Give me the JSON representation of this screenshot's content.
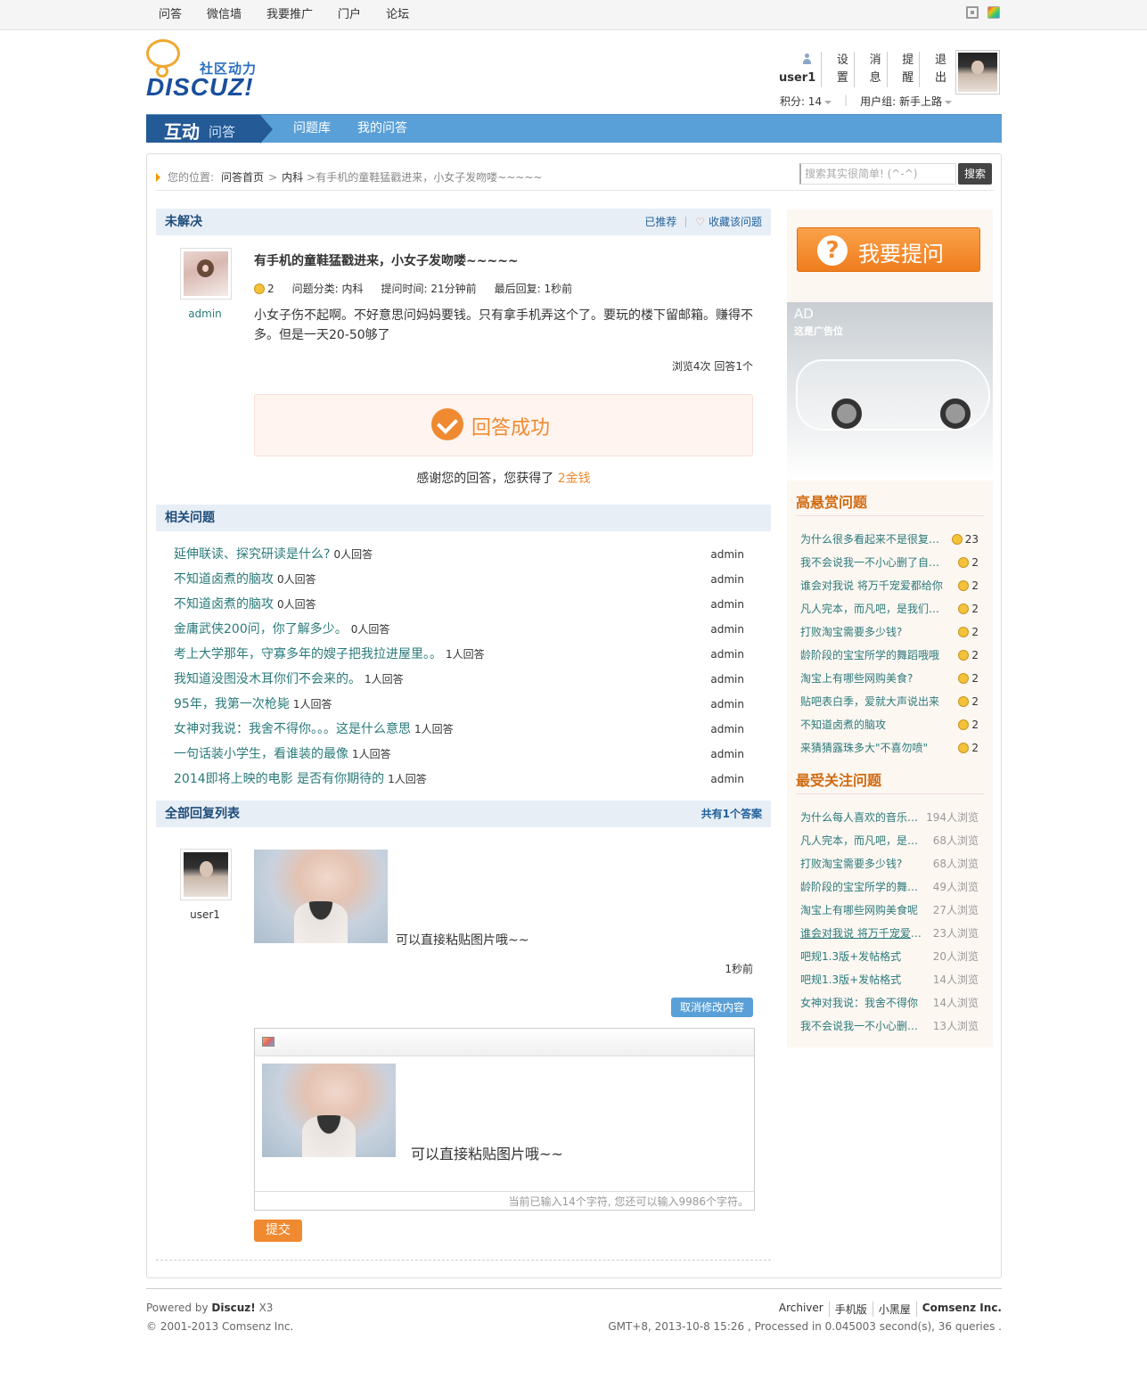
{
  "topnav": {
    "items": [
      "问答",
      "微信墙",
      "我要推广",
      "门户",
      "论坛"
    ]
  },
  "logo": {
    "subtitle": "社区动力",
    "brand": "DISCUZ!"
  },
  "user": {
    "name": "user1",
    "links": [
      "设置",
      "消息",
      "提醒",
      "退出"
    ],
    "points_label": "积分: 14",
    "group_label": "用户组: 新手上路"
  },
  "bluenav": {
    "brand_main": "互动",
    "brand_sub": "问答",
    "links": [
      "问题库",
      "我的问答"
    ]
  },
  "breadcrumb": {
    "prefix": "您的位置:",
    "home": "问答首页",
    "sep": ">",
    "category": "内科",
    "current": ">有手机的童鞋猛戳进来，小女子发吻喽~~~~~"
  },
  "search": {
    "placeholder": "搜索其实很简单! (^-^)",
    "button": "搜索"
  },
  "question": {
    "status": "未解决",
    "recommended": "已推荐",
    "favorite": "收藏该问题",
    "author": "admin",
    "title": "有手机的童鞋猛戳进来，小女子发吻喽~~~~~",
    "reward": "2",
    "category": "问题分类: 内科",
    "asked": "提问时间: 21分钟前",
    "last_reply": "最后回复: 1秒前",
    "body": "小女子伤不起啊。不好意思问妈妈要钱。只有拿手机弄这个了。要玩的楼下留邮箱。赚得不多。但是一天20-50够了",
    "stats": "浏览4次 回答1个"
  },
  "success": {
    "message": "回答成功",
    "thanks_prefix": "感谢您的回答，您获得了",
    "thanks_reward": "2金钱"
  },
  "related": {
    "title": "相关问题",
    "items": [
      {
        "title": "延伸联读、探究研读是什么?",
        "count": "0人回答",
        "author": "admin"
      },
      {
        "title": "不知道卤煮的脑攻",
        "count": "0人回答",
        "author": "admin"
      },
      {
        "title": "不知道卤煮的脑攻",
        "count": "0人回答",
        "author": "admin"
      },
      {
        "title": "金庸武侠200问，你了解多少。",
        "count": "0人回答",
        "author": "admin"
      },
      {
        "title": "考上大学那年，守寡多年的嫂子把我拉进屋里。。",
        "count": "1人回答",
        "author": "admin"
      },
      {
        "title": "我知道没图没木耳你们不会来的。",
        "count": "1人回答",
        "author": "admin"
      },
      {
        "title": "95年，我第一次枪毙",
        "count": "1人回答",
        "author": "admin"
      },
      {
        "title": "女神对我说：我舍不得你。。。这是什么意思",
        "count": "1人回答",
        "author": "admin"
      },
      {
        "title": "一句话装小学生，看谁装的最像",
        "count": "1人回答",
        "author": "admin"
      },
      {
        "title": "2014即将上映的电影 是否有你期待的",
        "count": "1人回答",
        "author": "admin"
      }
    ]
  },
  "replies": {
    "title": "全部回复列表",
    "total_prefix": "共有",
    "total_count": "1",
    "total_suffix": "个答案",
    "item": {
      "author": "user1",
      "text": "可以直接粘贴图片哦~~",
      "time": "1秒前"
    },
    "cancel_button": "取消修改内容"
  },
  "editor": {
    "text": "可以直接粘贴图片哦~~",
    "counter": "当前已输入14个字符, 您还可以输入9986个字符。",
    "submit": "提交"
  },
  "sidebar": {
    "ask_button": "我要提问",
    "ask_icon_glyph": "?",
    "ad_title": "AD",
    "ad_subtitle": "这是广告位",
    "reward_title": "高悬赏问题",
    "reward_items": [
      {
        "title": "为什么很多看起来不是很复杂的网站",
        "value": "23"
      },
      {
        "title": "我不会说我一不小心删了自己的",
        "value": "2"
      },
      {
        "title": "谁会对我说 将万千宠爱都给你",
        "value": "2"
      },
      {
        "title": "凡人完本，而凡吧，是我们的家",
        "value": "2"
      },
      {
        "title": "打败淘宝需要多少钱?",
        "value": "2"
      },
      {
        "title": "龄阶段的宝宝所学的舞蹈哦哦",
        "value": "2"
      },
      {
        "title": "淘宝上有哪些网购美食?",
        "value": "2"
      },
      {
        "title": "贴吧表白季，爱就大声说出来",
        "value": "2"
      },
      {
        "title": "不知道卤煮的脑攻",
        "value": "2"
      },
      {
        "title": "来猜猜露珠多大\"不喜勿喷\"",
        "value": "2"
      }
    ],
    "hot_title": "最受关注问题",
    "hot_items": [
      {
        "title": "为什么每人喜欢的音乐都不一样",
        "value": "194人浏览"
      },
      {
        "title": "凡人完本，而凡吧，是我们的家",
        "value": "68人浏览"
      },
      {
        "title": "打败淘宝需要多少钱?",
        "value": "68人浏览"
      },
      {
        "title": "龄阶段的宝宝所学的舞蹈哦",
        "value": "49人浏览"
      },
      {
        "title": "淘宝上有哪些网购美食呢",
        "value": "27人浏览"
      },
      {
        "title": "谁会对我说 将万千宠爱都给你",
        "value": "23人浏览"
      },
      {
        "title": "吧规1.3版+发帖格式",
        "value": "20人浏览"
      },
      {
        "title": "吧规1.3版+发帖格式",
        "value": "14人浏览"
      },
      {
        "title": "女神对我说：我舍不得你",
        "value": "14人浏览"
      },
      {
        "title": "我不会说我一不小心删了自己的",
        "value": "13人浏览"
      }
    ]
  },
  "footer": {
    "powered_prefix": "Powered by",
    "powered_brand": "Discuz!",
    "powered_version": "X3",
    "copyright": "© 2001-2013 Comsenz Inc.",
    "links": [
      "Archiver",
      "手机版",
      "小黑屋",
      "Comsenz Inc."
    ],
    "stats": "GMT+8, 2013-10-8 15:26 , Processed in 0.045003 second(s), 36 queries ."
  }
}
